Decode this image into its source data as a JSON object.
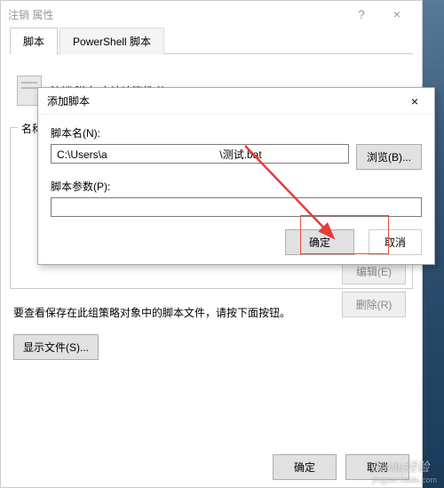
{
  "parent": {
    "title": "注销 属性",
    "help_icon": "?",
    "close_icon": "×",
    "tabs": [
      "脚本",
      "PowerShell 脚本"
    ],
    "icon_caption": "注销 脚本(本地计算机 的)",
    "group_label": "名称",
    "side_buttons": {
      "edit": "编辑(E)",
      "remove": "删除(R)"
    },
    "info_text": "要查看保存在此组策略对象中的脚本文件，请按下面按钮。",
    "show_files": "显示文件(S)...",
    "ok": "确定",
    "cancel": "取消"
  },
  "modal": {
    "title": "添加脚本",
    "close_icon": "×",
    "name_label": "脚本名(N):",
    "name_value": "C:\\Users\\a                                      \\测试.bat",
    "browse": "浏览(B)...",
    "params_label": "脚本参数(P):",
    "params_value": "",
    "ok": "确定",
    "cancel": "取消"
  },
  "watermark": {
    "main": "Baidu经验",
    "sub": "jingyan.baidu.com"
  }
}
